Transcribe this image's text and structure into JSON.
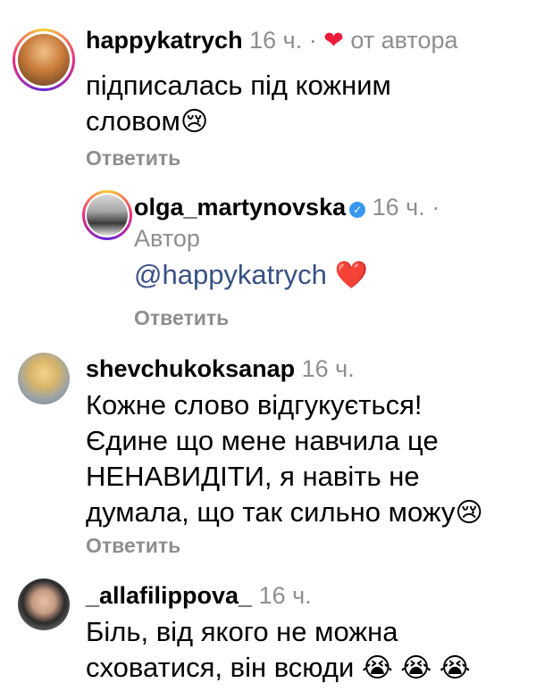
{
  "comments": [
    {
      "username": "happykatrych",
      "time": "16 ч.",
      "separator": "·",
      "liked_label": "от автора",
      "heart_icon": "❤",
      "text_lines": [
        "підписалась під кожним",
        "словом"
      ],
      "emoji": "😢",
      "reply_label": "Ответить"
    },
    {
      "username": "olga_martynovska",
      "time": "16 ч.",
      "separator": "·",
      "role": "Автор",
      "mention": "@happykatrych",
      "emoji": "❤️",
      "reply_label": "Ответить"
    },
    {
      "username": "shevchukoksanap",
      "time": "16 ч.",
      "text_lines": [
        "Кожне слово відгукується!",
        "Єдине що мене навчила це",
        "НЕНАВИДІТИ, я навіть не",
        "думала, що так сильно можу"
      ],
      "emoji": "😢",
      "reply_label": "Ответить"
    },
    {
      "username": "_allafilippova_",
      "time": "16 ч.",
      "text_lines": [
        "Біль, від якого не можна",
        "сховатися, він всюди"
      ],
      "emoji": "😭 😭 😭"
    }
  ],
  "colors": {
    "muted": "#8e8e8e",
    "mention": "#385185",
    "heart": "#ed1c3d",
    "verified": "#3897f0"
  },
  "icons": {
    "verified": "verified-badge-icon",
    "heart": "heart-icon"
  }
}
